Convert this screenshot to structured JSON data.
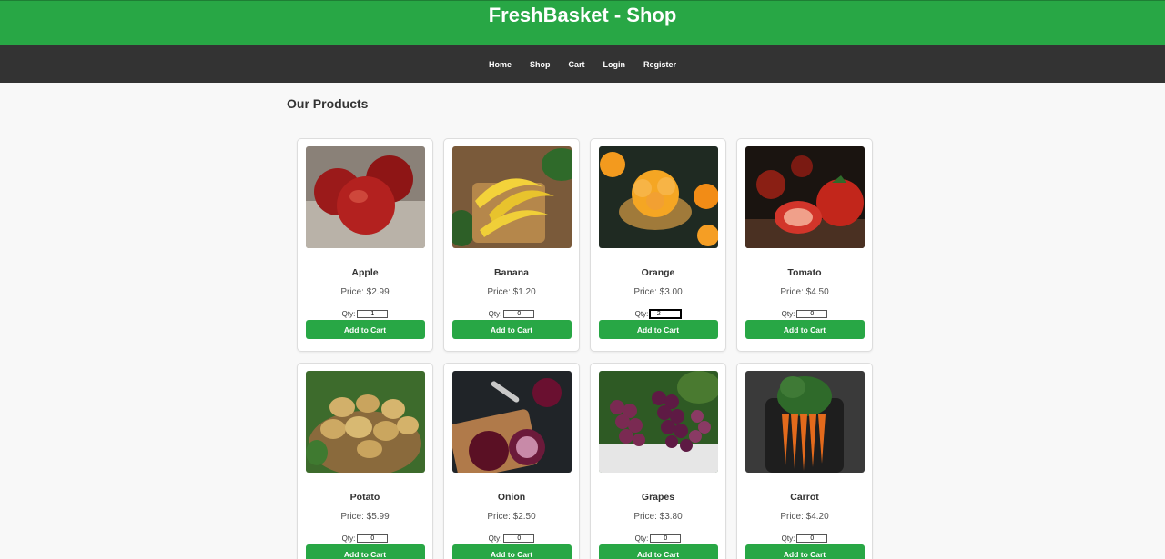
{
  "header": {
    "title": "FreshBasket - Shop"
  },
  "nav": {
    "items": [
      "Home",
      "Shop",
      "Cart",
      "Login",
      "Register"
    ]
  },
  "main": {
    "section_title": "Our Products",
    "qty_label": "Qty:",
    "add_label": "Add to Cart",
    "products": [
      {
        "name": "Apple",
        "price": "Price: $2.99",
        "qty": "1"
      },
      {
        "name": "Banana",
        "price": "Price: $1.20",
        "qty": "0"
      },
      {
        "name": "Orange",
        "price": "Price: $3.00",
        "qty": "2"
      },
      {
        "name": "Tomato",
        "price": "Price: $4.50",
        "qty": "0"
      },
      {
        "name": "Potato",
        "price": "Price: $5.99",
        "qty": "0"
      },
      {
        "name": "Onion",
        "price": "Price: $2.50",
        "qty": "0"
      },
      {
        "name": "Grapes",
        "price": "Price: $3.80",
        "qty": "0"
      },
      {
        "name": "Carrot",
        "price": "Price: $4.20",
        "qty": "0"
      }
    ]
  },
  "colors": {
    "brand": "#28a745",
    "nav": "#333333",
    "background": "#f8f8f8"
  }
}
